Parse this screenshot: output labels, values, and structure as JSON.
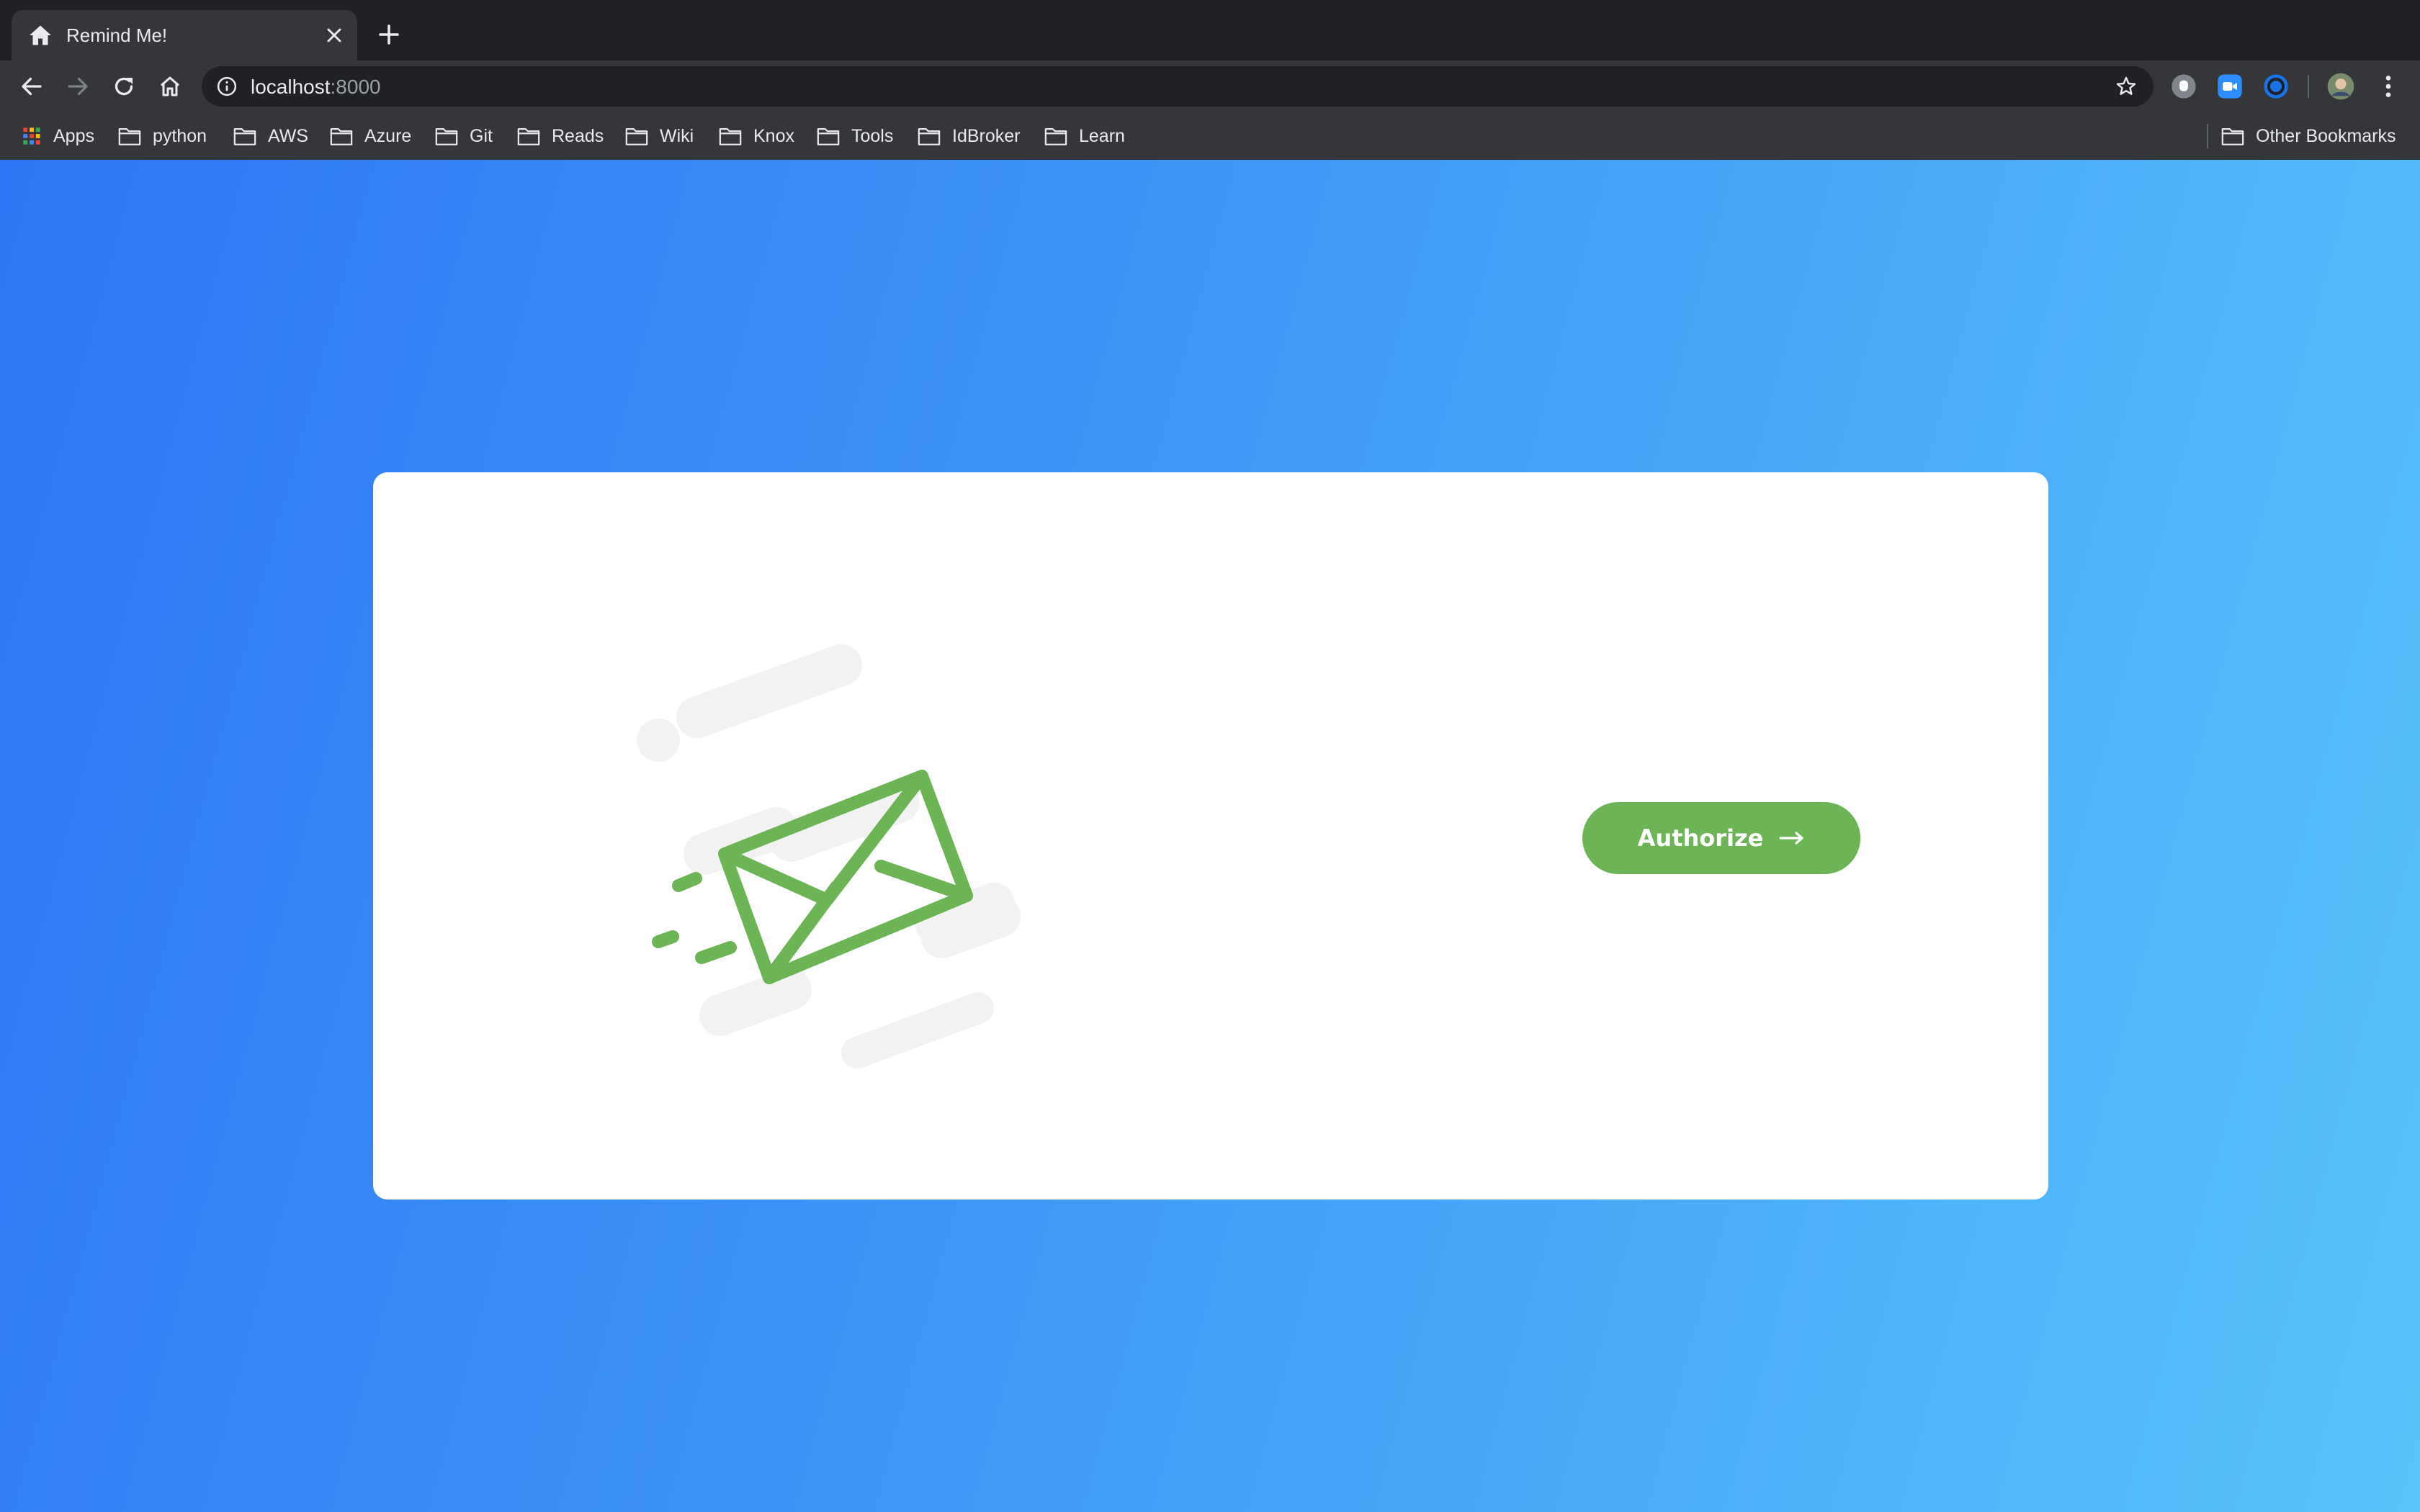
{
  "browser": {
    "tab": {
      "title": "Remind Me!"
    },
    "address": {
      "host": "localhost",
      "port": ":8000"
    },
    "bookmarks": [
      {
        "label": "Apps",
        "icon": "apps-grid-icon"
      },
      {
        "label": "python",
        "icon": "folder-icon"
      },
      {
        "label": "AWS",
        "icon": "folder-icon"
      },
      {
        "label": "Azure",
        "icon": "folder-icon"
      },
      {
        "label": "Git",
        "icon": "folder-icon"
      },
      {
        "label": "Reads",
        "icon": "folder-icon"
      },
      {
        "label": "Wiki",
        "icon": "folder-icon"
      },
      {
        "label": "Knox",
        "icon": "folder-icon"
      },
      {
        "label": "Tools",
        "icon": "folder-icon"
      },
      {
        "label": "IdBroker",
        "icon": "folder-icon"
      },
      {
        "label": "Learn",
        "icon": "folder-icon"
      }
    ],
    "other_bookmarks": "Other Bookmarks"
  },
  "page": {
    "authorize_label": "Authorize",
    "colors": {
      "accent_green": "#6cb455",
      "gradient_start": "#2e77f6",
      "gradient_end": "#58c4fb"
    }
  }
}
